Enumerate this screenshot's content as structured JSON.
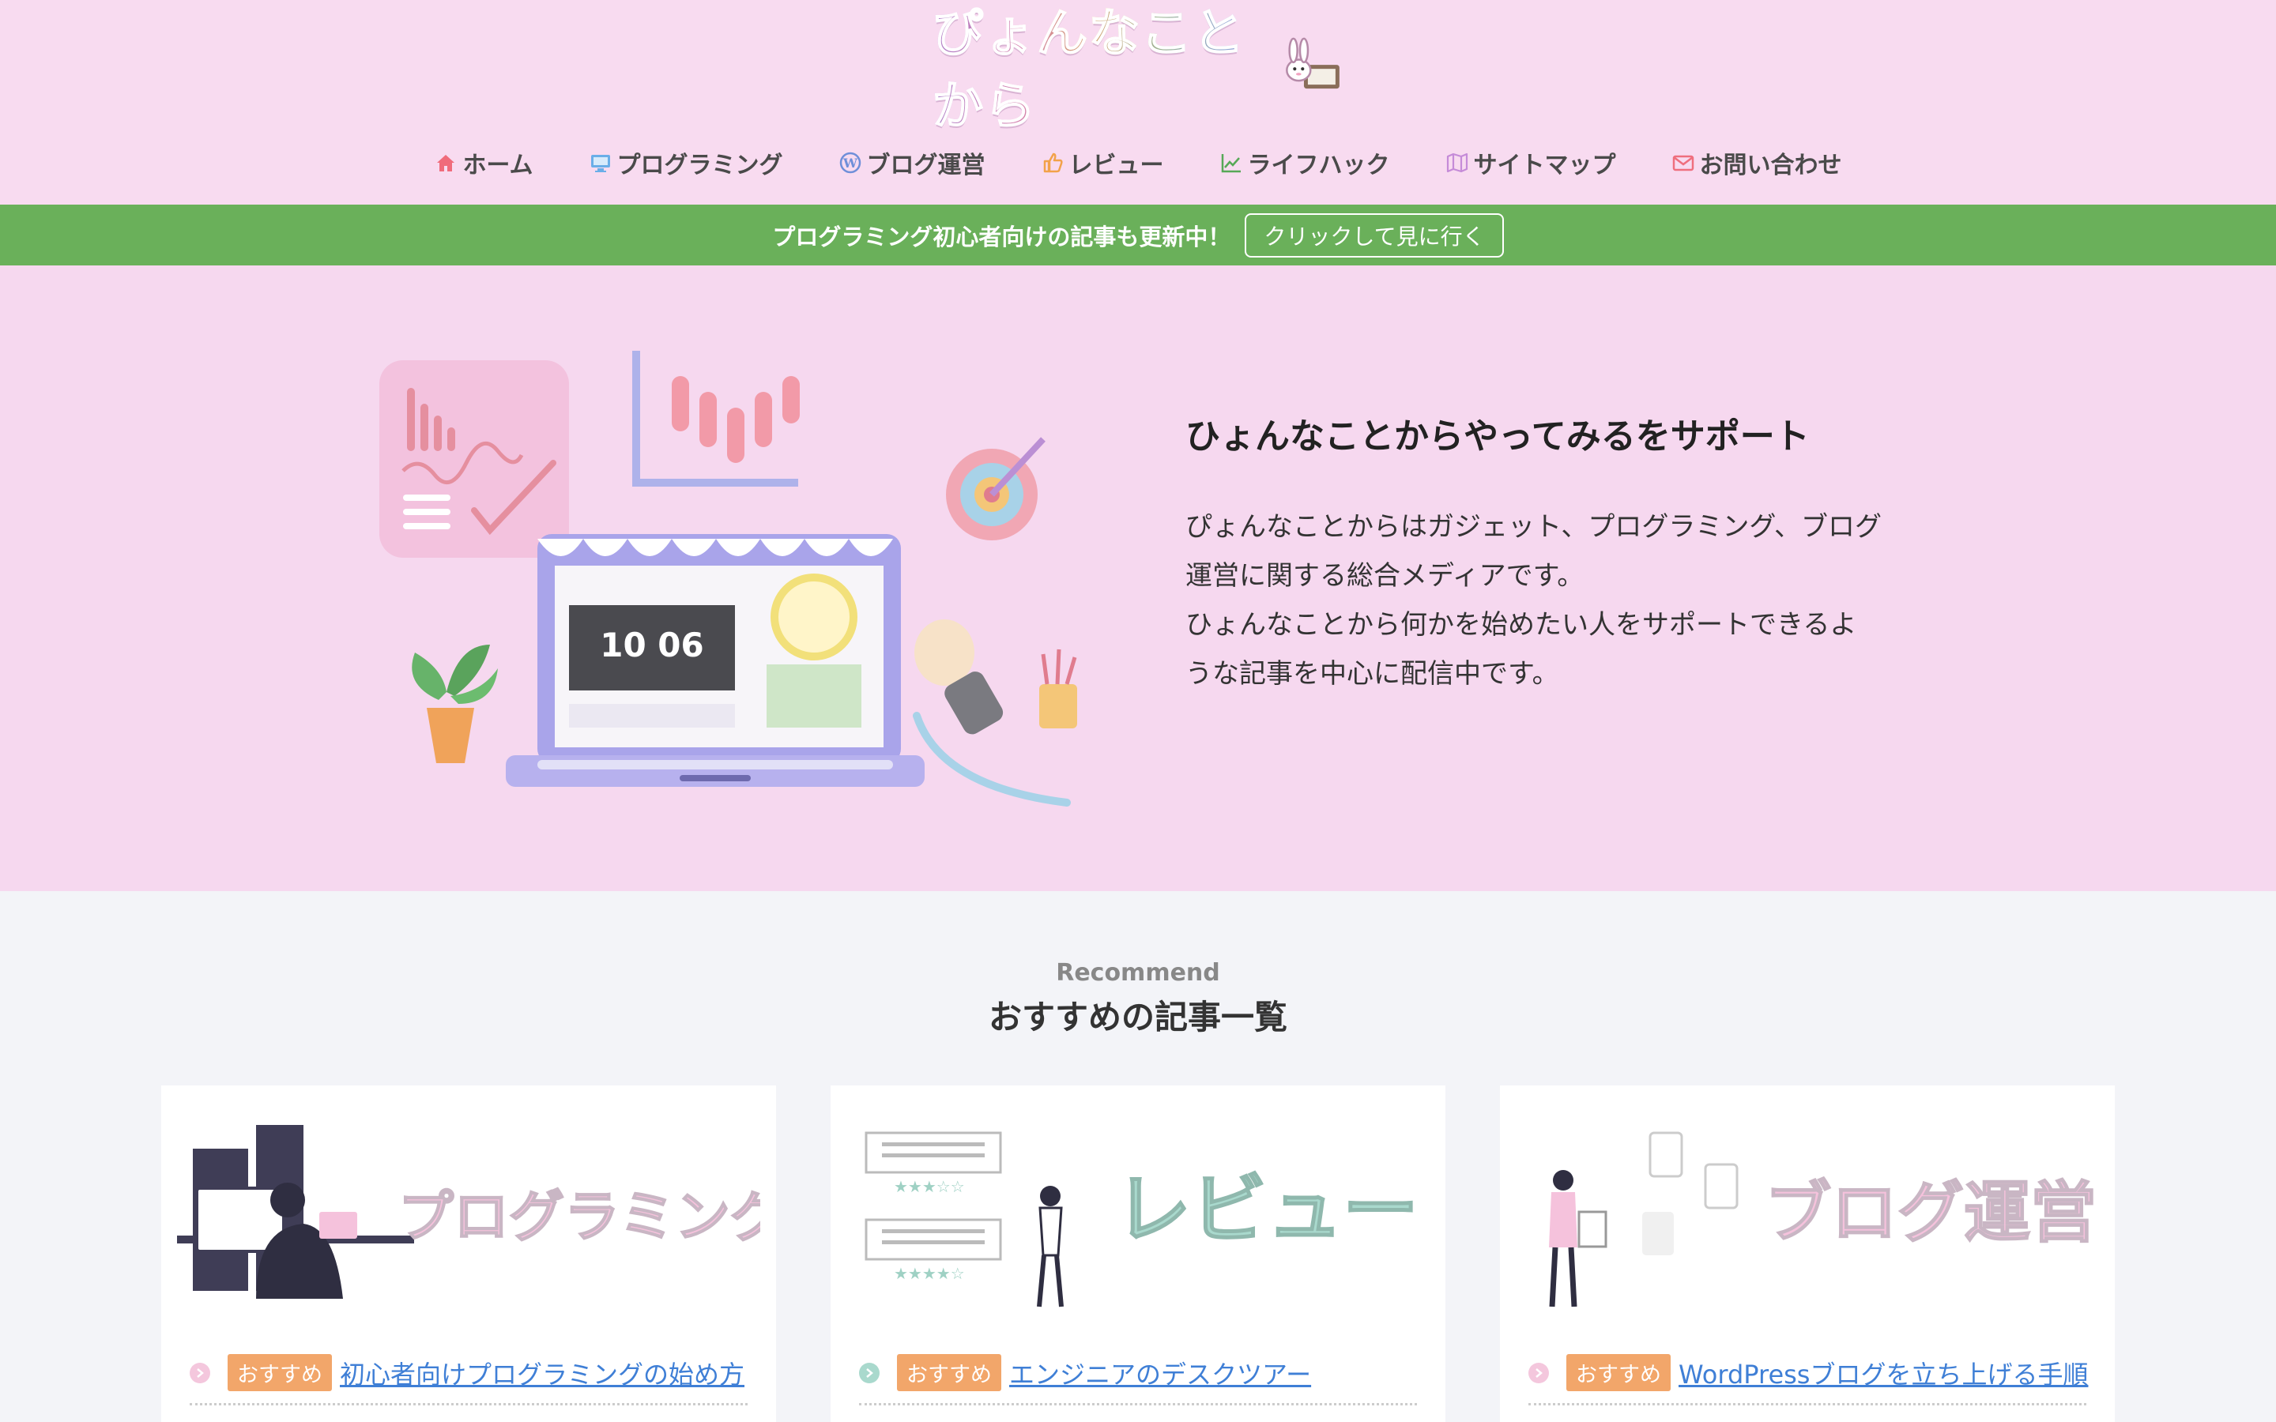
{
  "site": {
    "logo_text": "ぴょんなことから"
  },
  "nav": [
    {
      "label": "ホーム",
      "icon": "home-icon",
      "color": "#f06b7b"
    },
    {
      "label": "プログラミング",
      "icon": "monitor-icon",
      "color": "#6aaee8"
    },
    {
      "label": "ブログ運営",
      "icon": "wordpress-icon",
      "color": "#6f8fd9"
    },
    {
      "label": "レビュー",
      "icon": "thumbs-up-icon",
      "color": "#f2a24a"
    },
    {
      "label": "ライフハック",
      "icon": "chart-line-icon",
      "color": "#57a957"
    },
    {
      "label": "サイトマップ",
      "icon": "map-icon",
      "color": "#c58bd8"
    },
    {
      "label": "お問い合わせ",
      "icon": "mail-icon",
      "color": "#ef6f7e"
    }
  ],
  "notice": {
    "text": "プログラミング初心者向けの記事も更新中！",
    "button": "クリックして見に行く",
    "color": "#6ab05a"
  },
  "hero": {
    "title": "ひょんなことからやってみるをサポート",
    "desc": [
      "ぴょんなことからはガジェット、プログラミング、ブログ",
      "運営に関する総合メディアです。",
      "ひょんなことから何かを始めたい人をサポートできるよ",
      "うな記事を中心に配信中です。"
    ],
    "screen_clock": "10 06"
  },
  "recommend": {
    "subtitle": "Recommend",
    "title": "おすすめの記事一覧",
    "cards": [
      {
        "image_text": "プログラミング",
        "badge": "おすすめ",
        "link": "初心者向けプログラミングの始め方",
        "accent": "#f5c2dc"
      },
      {
        "image_text": "レビュー",
        "badge": "おすすめ",
        "link": "エンジニアのデスクツアー",
        "accent": "#a9d9cd"
      },
      {
        "image_text": "ブログ運営",
        "badge": "おすすめ",
        "link": "WordPressブログを立ち上げる手順",
        "accent": "#f5c2dc"
      }
    ]
  }
}
